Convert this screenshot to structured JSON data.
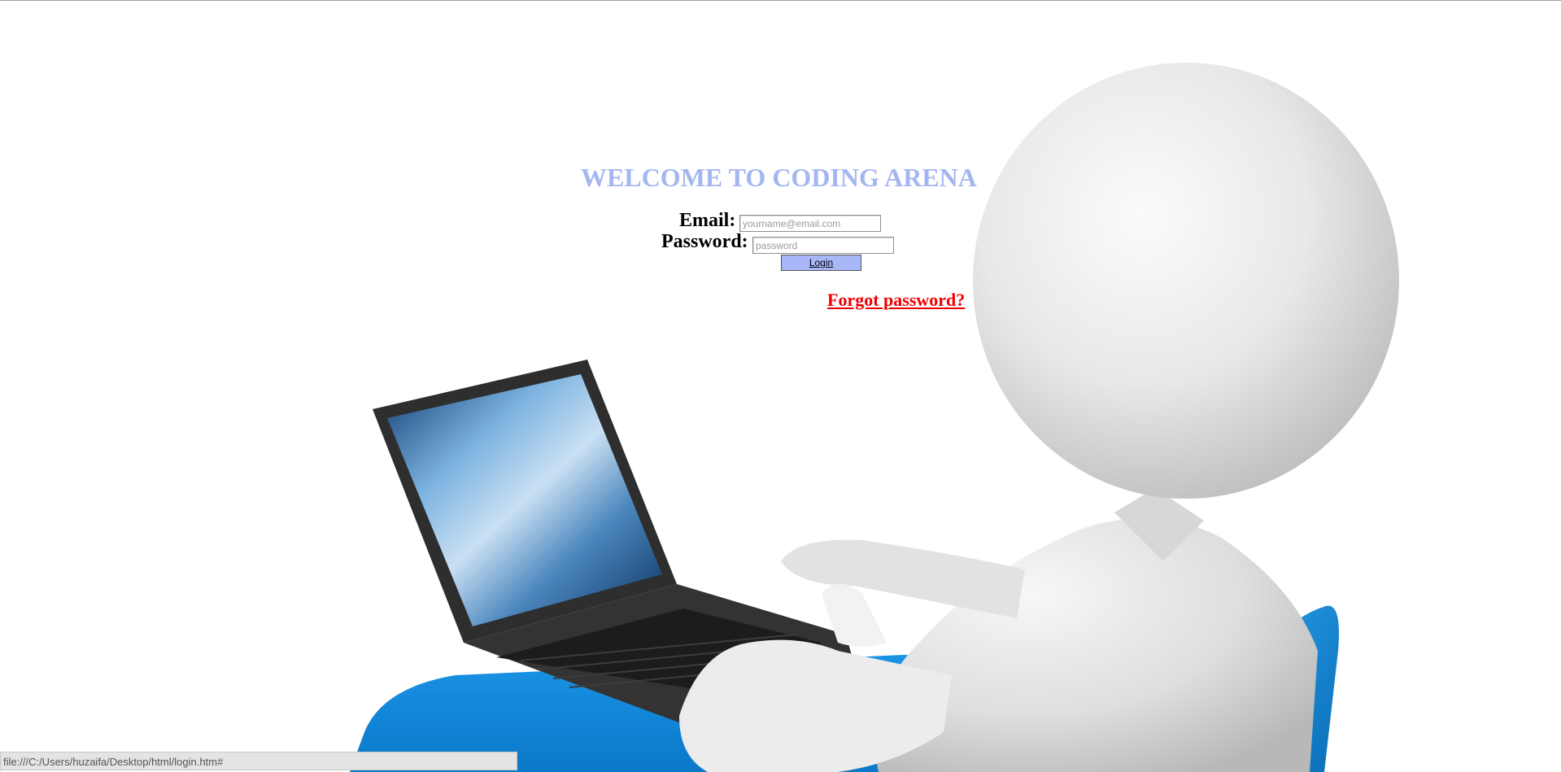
{
  "page": {
    "title": "WELCOME TO CODING ARENA"
  },
  "login_form": {
    "email_label": "Email:",
    "email_placeholder": "yourname@email.com",
    "email_value": "",
    "password_label": "Password:",
    "password_placeholder": "password",
    "password_value": "",
    "login_button_label": "Login",
    "forgot_password_label": "Forgot password?"
  },
  "status_bar": {
    "url": "file:///C:/Users/huzaifa/Desktop/html/login.htm#"
  },
  "background": {
    "description_icon": "3d-person-at-laptop-illustration"
  },
  "colors": {
    "title": "#a4b6f2",
    "login_button": "#a8b7f7",
    "forgot_link": "#ee0000",
    "chair_blue": "#1a8ad8",
    "figure_white": "#e6e6e6",
    "laptop_dark": "#2d2d2d"
  }
}
